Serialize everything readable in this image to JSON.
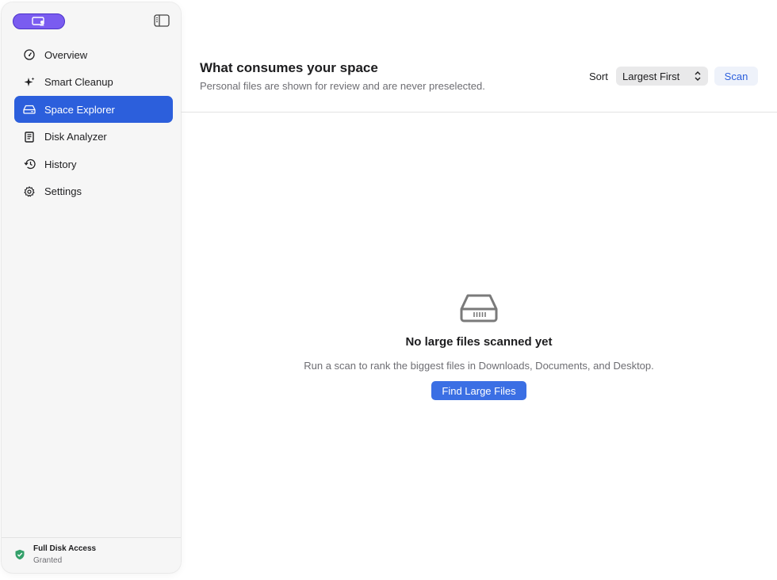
{
  "sidebar": {
    "items": [
      {
        "label": "Overview",
        "icon": "gauge-icon"
      },
      {
        "label": "Smart Cleanup",
        "icon": "sparkle-icon"
      },
      {
        "label": "Space Explorer",
        "icon": "drive-icon",
        "active": true
      },
      {
        "label": "Disk Analyzer",
        "icon": "document-icon"
      },
      {
        "label": "History",
        "icon": "history-icon"
      },
      {
        "label": "Settings",
        "icon": "gear-icon"
      }
    ],
    "footer": {
      "title": "Full Disk Access",
      "status": "Granted"
    }
  },
  "header": {
    "title": "What consumes your space",
    "subtitle": "Personal files are shown for review and are never preselected.",
    "sort_label": "Sort",
    "sort_value": "Largest First",
    "scan_label": "Scan"
  },
  "empty_state": {
    "title": "No large files scanned yet",
    "description": "Run a scan to rank the biggest files in Downloads, Documents, and Desktop.",
    "button_label": "Find Large Files"
  },
  "colors": {
    "accent": "#2c5fdc",
    "badge": "#7a5cf0",
    "granted": "#34a06a"
  }
}
